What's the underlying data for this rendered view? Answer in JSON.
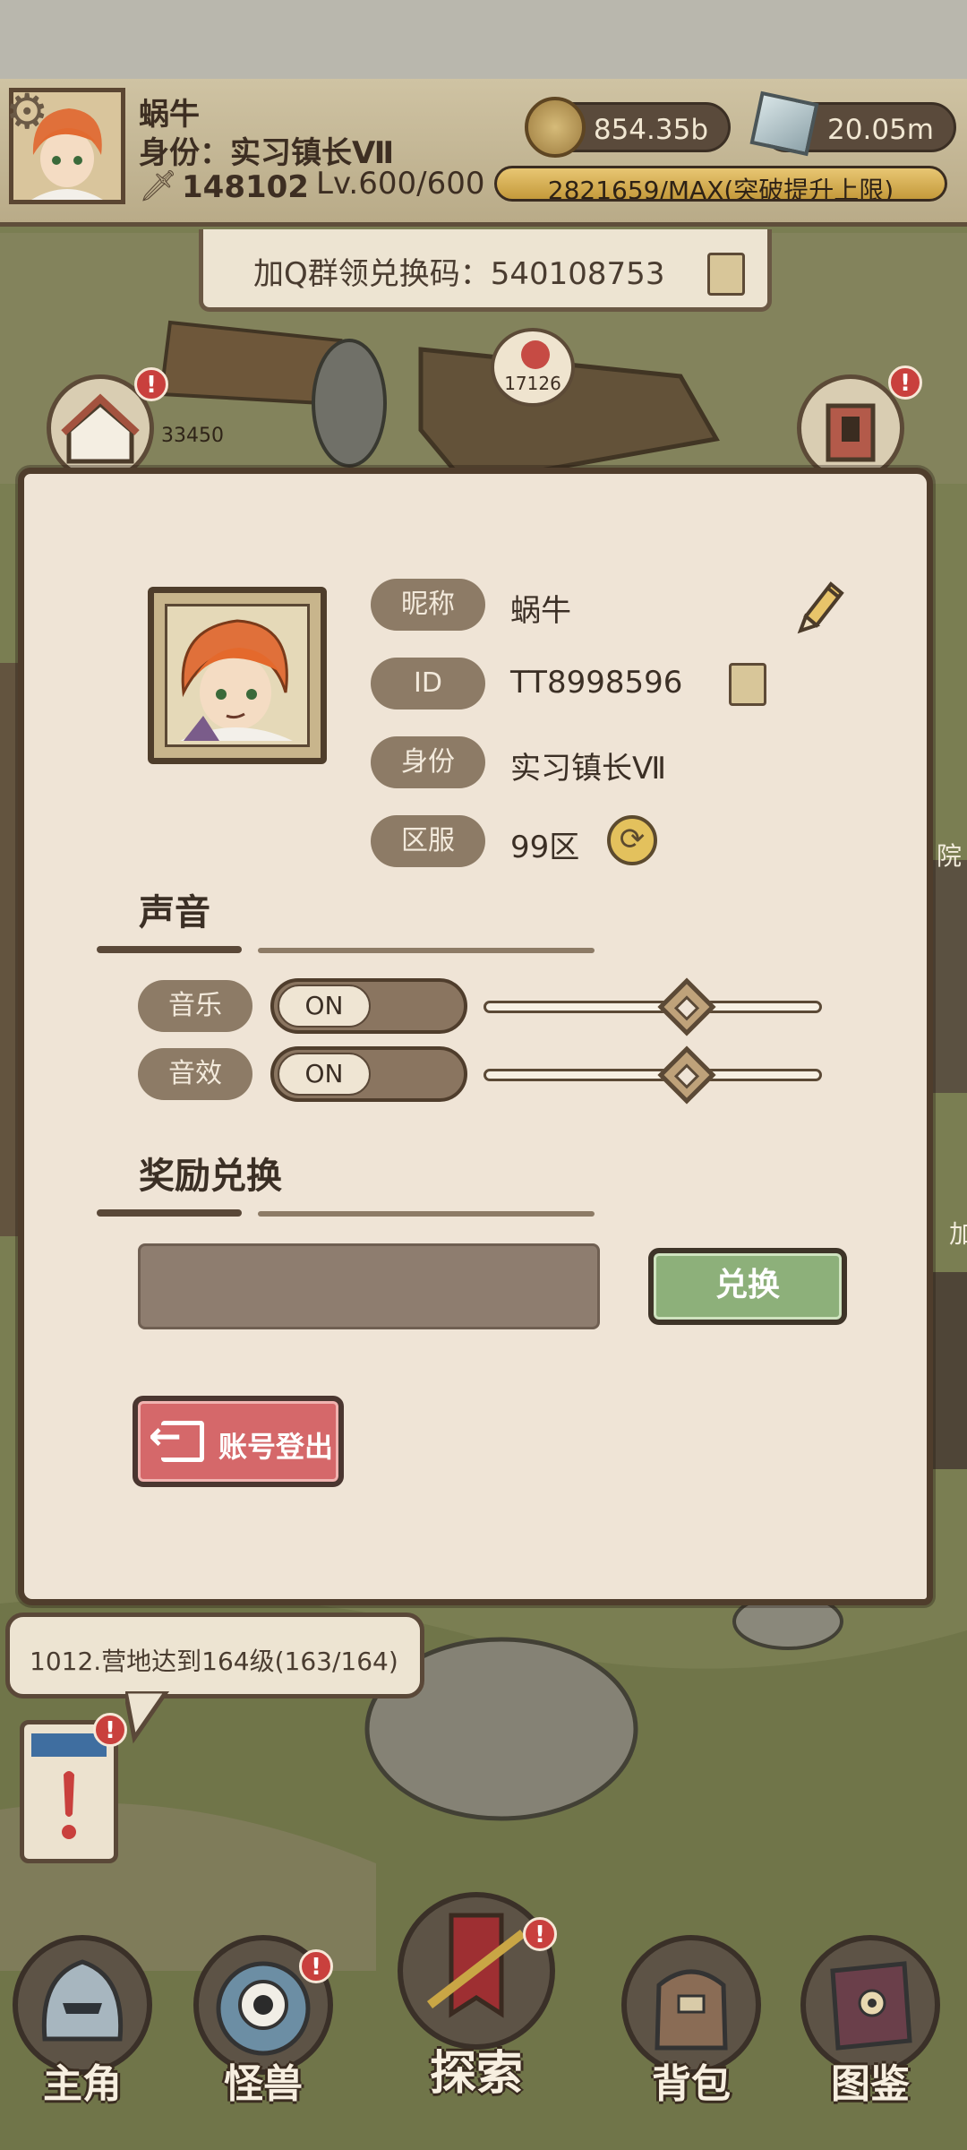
{
  "hud": {
    "player_name": "蜗牛",
    "title": "身份：实习镇长Ⅶ",
    "power": "148102",
    "level": "Lv.600/600",
    "coins": "854.35b",
    "gems": "20.05m",
    "exp_text": "2821659/MAX(突破提升上限)",
    "exp_fill_fraction": 1.0
  },
  "banner": {
    "text": "加Q群领兑换码：540108753"
  },
  "map": {
    "berry_count": "17126",
    "egg_count": "33450",
    "notice_mark": "!",
    "side_text_right_1": "院",
    "side_text_right_2": "加"
  },
  "profile": {
    "labels": {
      "nickname": "昵称",
      "id": "ID",
      "identity": "身份",
      "server": "区服"
    },
    "values": {
      "nickname": "蜗牛",
      "id": "TT8998596",
      "identity": "实习镇长Ⅶ",
      "server": "99区"
    }
  },
  "sound": {
    "title": "声音",
    "music_label": "音乐",
    "music_state": "ON",
    "music_volume": 0.6,
    "sfx_label": "音效",
    "sfx_state": "ON",
    "sfx_volume": 0.6
  },
  "reward": {
    "title": "奖励兑换",
    "code_value": "",
    "redeem_label": "兑换"
  },
  "logout": {
    "label": "账号登出"
  },
  "quest": {
    "text": "1012.营地达到164级(163/164)"
  },
  "nav": [
    {
      "label": "主角"
    },
    {
      "label": "怪兽"
    },
    {
      "label": "探索"
    },
    {
      "label": "背包"
    },
    {
      "label": "图鉴"
    }
  ],
  "colors": {
    "panel_bg": "#efe4d6",
    "panel_border": "#4f3d2c",
    "tag_bg": "#8d7b66",
    "redeem_green": "#8db07a",
    "logout_red": "#d5686a",
    "badge_red": "#c9403d"
  }
}
